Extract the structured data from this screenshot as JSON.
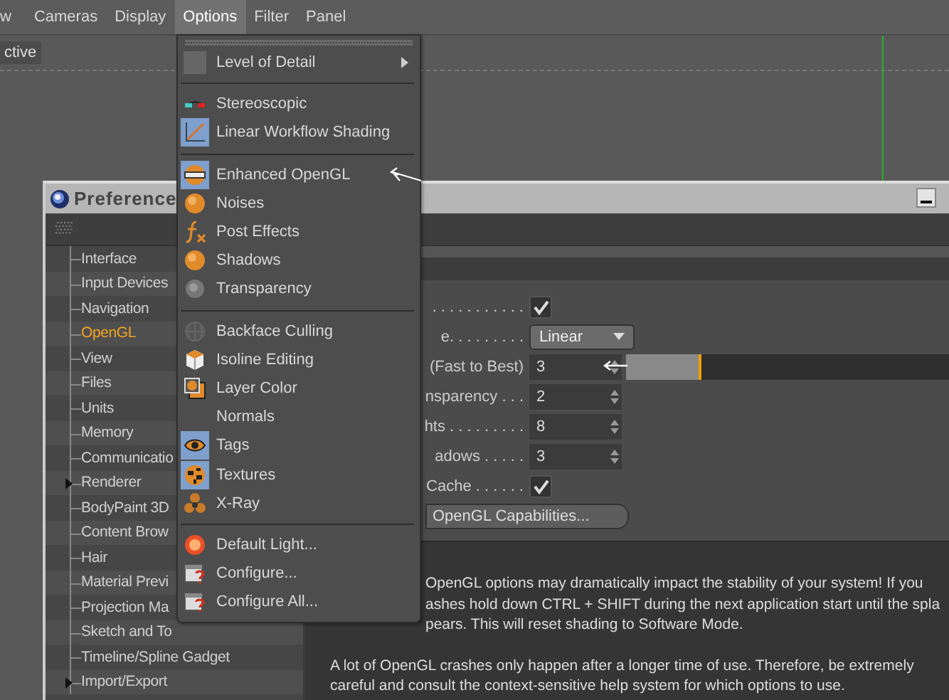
{
  "menubar": [
    {
      "label": "w",
      "selected": false
    },
    {
      "label": "Cameras",
      "selected": false
    },
    {
      "label": "Display",
      "selected": false
    },
    {
      "label": "Options",
      "selected": true
    },
    {
      "label": "Filter",
      "selected": false
    },
    {
      "label": "Panel",
      "selected": false
    }
  ],
  "viewport": {
    "tag": "ctive"
  },
  "menu": {
    "groups": [
      {
        "items": [
          {
            "label": "Level of Detail",
            "checked": false,
            "submenu": true
          }
        ]
      },
      {
        "items": [
          {
            "label": "Stereoscopic",
            "checked": false,
            "submenu": false
          },
          {
            "label": "Linear Workflow Shading",
            "checked": true,
            "submenu": false
          }
        ]
      },
      {
        "items": [
          {
            "label": "Enhanced OpenGL",
            "checked": true,
            "submenu": false
          },
          {
            "label": "Noises",
            "checked": false,
            "submenu": false
          },
          {
            "label": "Post Effects",
            "checked": false,
            "submenu": false
          },
          {
            "label": "Shadows",
            "checked": false,
            "submenu": false
          },
          {
            "label": "Transparency",
            "checked": false,
            "submenu": false
          }
        ]
      },
      {
        "items": [
          {
            "label": "Backface Culling",
            "checked": false,
            "submenu": false
          },
          {
            "label": "Isoline Editing",
            "checked": false,
            "submenu": false
          },
          {
            "label": "Layer Color",
            "checked": false,
            "submenu": false
          },
          {
            "label": "Normals",
            "checked": false,
            "submenu": false
          },
          {
            "label": "Tags",
            "checked": true,
            "submenu": false
          },
          {
            "label": "Textures",
            "checked": true,
            "submenu": false
          },
          {
            "label": "X-Ray",
            "checked": false,
            "submenu": false
          }
        ]
      },
      {
        "items": [
          {
            "label": "Default Light...",
            "checked": false,
            "submenu": false
          },
          {
            "label": "Configure...",
            "checked": false,
            "submenu": false
          },
          {
            "label": "Configure All...",
            "checked": false,
            "submenu": false
          }
        ]
      }
    ]
  },
  "window": {
    "title": "Preference",
    "tree": [
      {
        "label": "Interface",
        "selected": false,
        "has_children": false
      },
      {
        "label": "Input Devices",
        "selected": false,
        "has_children": false
      },
      {
        "label": "Navigation",
        "selected": false,
        "has_children": false
      },
      {
        "label": "OpenGL",
        "selected": true,
        "has_children": false
      },
      {
        "label": "View",
        "selected": false,
        "has_children": false
      },
      {
        "label": "Files",
        "selected": false,
        "has_children": false
      },
      {
        "label": "Units",
        "selected": false,
        "has_children": false
      },
      {
        "label": "Memory",
        "selected": false,
        "has_children": false
      },
      {
        "label": "Communicatio",
        "selected": false,
        "has_children": false
      },
      {
        "label": "Renderer",
        "selected": false,
        "has_children": true
      },
      {
        "label": "BodyPaint 3D",
        "selected": false,
        "has_children": false
      },
      {
        "label": "Content Brow",
        "selected": false,
        "has_children": false
      },
      {
        "label": "Hair",
        "selected": false,
        "has_children": false
      },
      {
        "label": "Material Previ",
        "selected": false,
        "has_children": false
      },
      {
        "label": "Projection Ma",
        "selected": false,
        "has_children": false
      },
      {
        "label": "Sketch and To",
        "selected": false,
        "has_children": false
      },
      {
        "label": "Timeline/Spline Gadget",
        "selected": false,
        "has_children": false
      },
      {
        "label": "Import/Export",
        "selected": false,
        "has_children": true
      }
    ],
    "settings": [
      {
        "kind": "checkbox",
        "label": ". . . . . . . . . . .",
        "checked": true
      },
      {
        "kind": "dropdown",
        "label": "e. . . . . . . . .",
        "value": "Linear"
      },
      {
        "kind": "slider",
        "label": "(Fast to Best)",
        "value": "3",
        "level": 0.21
      },
      {
        "kind": "number",
        "label": "nsparency . . .",
        "value": "2"
      },
      {
        "kind": "number",
        "label": "hts . . . . . . . . .",
        "value": "8"
      },
      {
        "kind": "number",
        "label": "adows . . . . .",
        "value": "3"
      },
      {
        "kind": "checkbox",
        "label": "Cache . . . . . .",
        "checked": true
      }
    ],
    "button": "OpenGL Capabilities...",
    "warning_lines": [
      "OpenGL options may dramatically impact the stability of your system! If you",
      "ashes hold down CTRL + SHIFT during the next application start until the spla",
      "pears. This will reset shading to Software Mode."
    ],
    "note": "A lot of OpenGL crashes only happen after a longer time of use. Therefore, be extremely careful and consult the context-sensitive help system for which options to use."
  }
}
